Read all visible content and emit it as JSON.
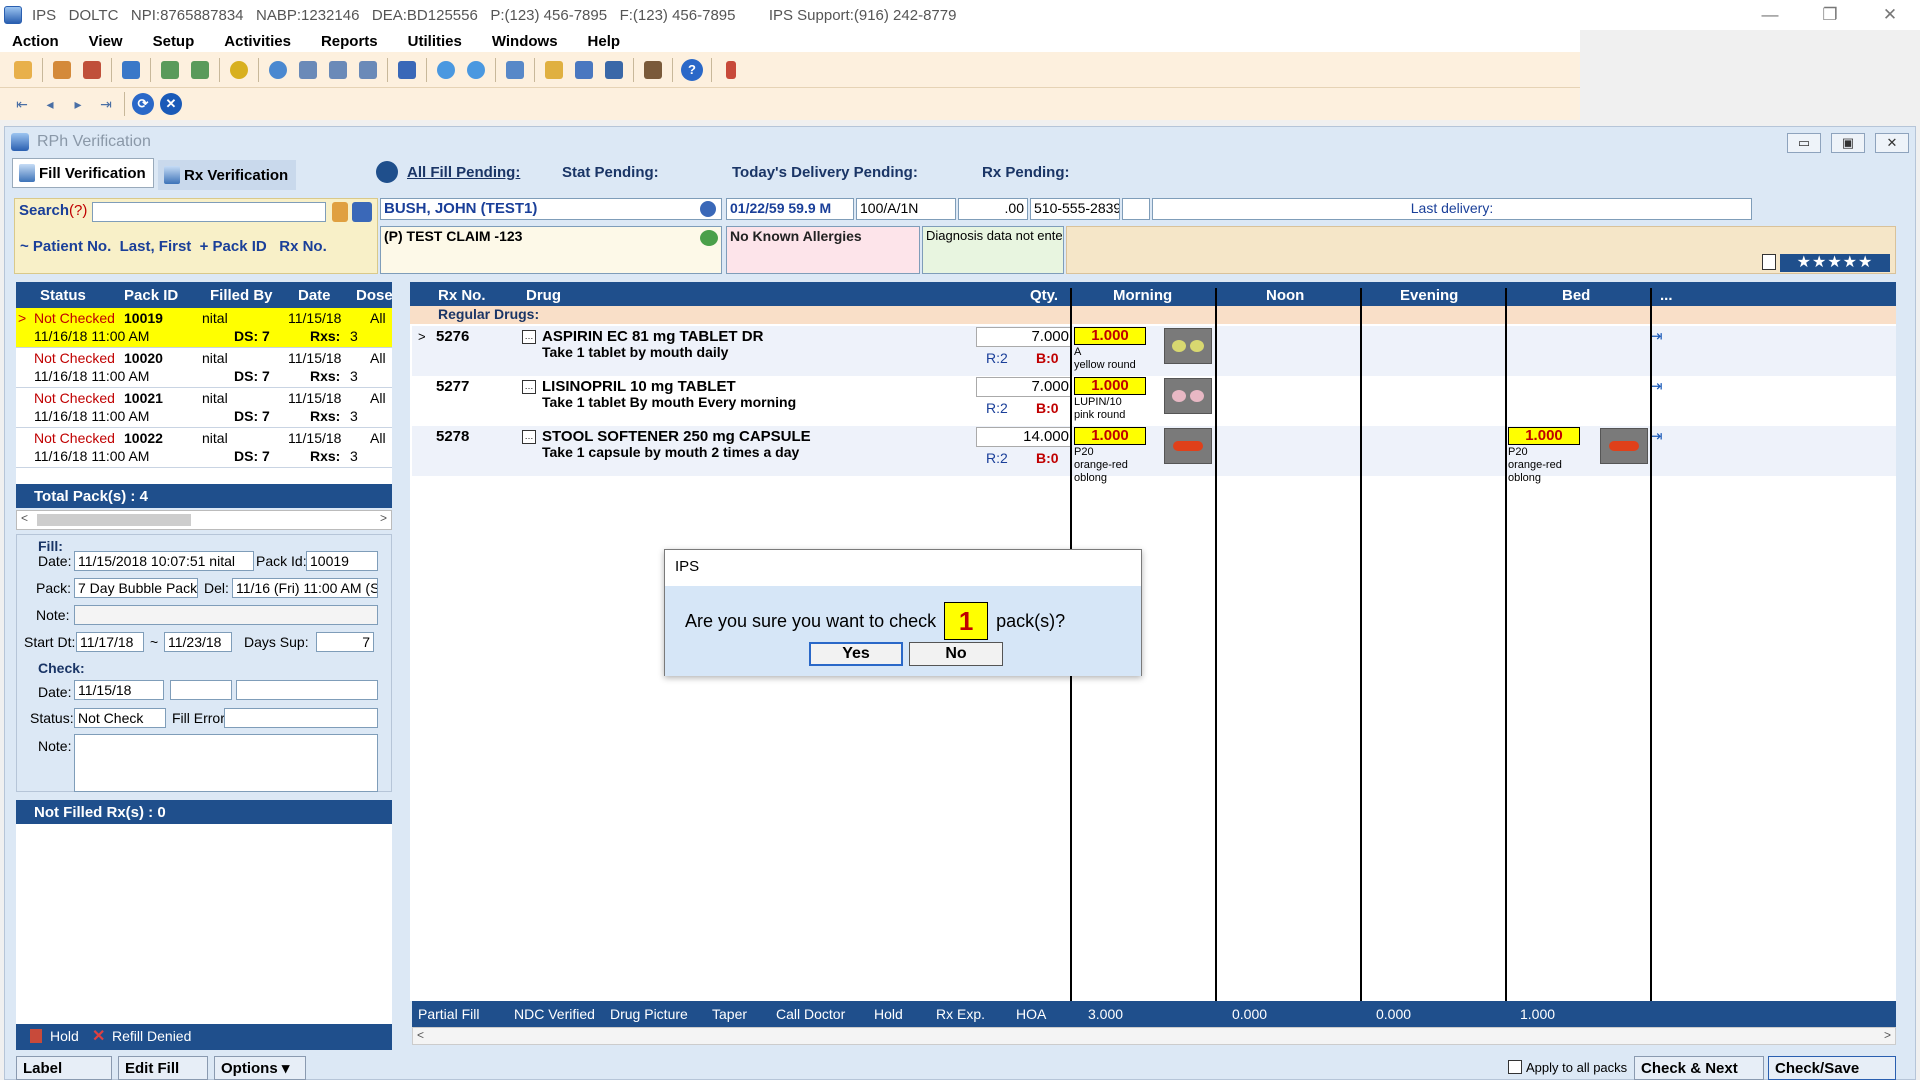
{
  "window": {
    "title": "IPS   DOLTC   NPI:8765887834   NABP:1232146   DEA:BD125556   P:(123) 456-7895   F:(123) 456-7895        IPS Support:(916) 242-8779",
    "minimize": "—",
    "restore": "❐",
    "close": "✕"
  },
  "menu": [
    "Action",
    "View",
    "Setup",
    "Activities",
    "Reports",
    "Utilities",
    "Windows",
    "Help"
  ],
  "toolbar": {
    "icons": [
      "user-icon",
      "users-icon",
      "home-icon",
      "pharmacy-icon",
      "export-icon",
      "import-icon",
      "money-icon",
      "search-icon",
      "filter-icon",
      "filter2-icon",
      "filter3-icon",
      "truck-icon",
      "merge-icon",
      "split-icon",
      "copy-icon",
      "folder-icon",
      "calendar-icon",
      "grid-icon",
      "book-icon",
      "help-icon",
      "exit-icon"
    ],
    "help": "?"
  },
  "nav": {
    "first": "⇤",
    "prev": "◂",
    "next": "▸",
    "last": "⇥",
    "refresh": "⟳",
    "stop": "✕"
  },
  "rph": {
    "title": "RPh Verification",
    "win_min": "▭",
    "win_max": "▣",
    "win_close": "✕",
    "tabs": {
      "fill": "Fill Verification",
      "rx": "Rx Verification"
    },
    "pending": {
      "all": "All Fill Pending:",
      "stat": "Stat Pending:",
      "today": "Today's Delivery Pending:",
      "rx": "Rx Pending:"
    },
    "search": {
      "label": "Search",
      "help": "(?)",
      "value": "",
      "hint": "~ Patient No.  Last, First  + Pack ID   Rx No."
    },
    "patient": {
      "name": "BUSH, JOHN  (TEST1)",
      "dob": "01/22/59 59.9 M",
      "room": "100/A/1N",
      "balance": ".00",
      "phone": "510-555-2839",
      "last_delivery": "Last delivery:",
      "claim": "(P) TEST CLAIM  -123",
      "allergies": "No Known Allergies",
      "diagnosis": "Diagnosis data not ente"
    },
    "packs": {
      "columns": [
        "Status",
        "Pack ID",
        "Filled By",
        "Date",
        "Dose"
      ],
      "rows": [
        {
          "status": "Not Checked",
          "pack_id": "10019",
          "filled_by": "nital",
          "date": "11/15/18",
          "dose": "All",
          "datetime": "11/16/18 11:00 AM",
          "ds": "DS: 7",
          "rxs_label": "Rxs:",
          "rxs": "3",
          "marker": ">"
        },
        {
          "status": "Not Checked",
          "pack_id": "10020",
          "filled_by": "nital",
          "date": "11/15/18",
          "dose": "All",
          "datetime": "11/16/18 11:00 AM",
          "ds": "DS: 7",
          "rxs_label": "Rxs:",
          "rxs": "3",
          "marker": ""
        },
        {
          "status": "Not Checked",
          "pack_id": "10021",
          "filled_by": "nital",
          "date": "11/15/18",
          "dose": "All",
          "datetime": "11/16/18 11:00 AM",
          "ds": "DS: 7",
          "rxs_label": "Rxs:",
          "rxs": "3",
          "marker": ""
        },
        {
          "status": "Not Checked",
          "pack_id": "10022",
          "filled_by": "nital",
          "date": "11/15/18",
          "dose": "All",
          "datetime": "11/16/18 11:00 AM",
          "ds": "DS: 7",
          "rxs_label": "Rxs:",
          "rxs": "3",
          "marker": ""
        }
      ],
      "total": "Total Pack(s) : 4"
    },
    "fill": {
      "heading": "Fill:",
      "date_label": "Date:",
      "date": "11/15/2018 10:07:51 nital",
      "packid_label": "Pack Id:",
      "pack_id": "10019",
      "pack_label": "Pack:",
      "pack": "7 Day Bubble Pack",
      "del_label": "Del:",
      "del": "11/16 (Fri)  11:00 AM (S",
      "note_label": "Note:",
      "note": "",
      "startdt_label": "Start Dt:",
      "start": "11/17/18",
      "dash": "~",
      "end": "11/23/18",
      "dayssup_label": "Days Sup:",
      "days_sup": "7"
    },
    "check": {
      "heading": "Check:",
      "date_label": "Date:",
      "date": "11/15/18",
      "status_label": "Status:",
      "status": "Not Check",
      "fillerror_label": "Fill Error:",
      "fill_error": "",
      "note_label": "Note:"
    },
    "not_filled": "Not Filled Rx(s) : 0",
    "left_footer": {
      "hold": "Hold",
      "refill_denied": "Refill Denied"
    },
    "grid": {
      "columns": [
        "Rx No.",
        "Drug",
        "Qty.",
        "Morning",
        "Noon",
        "Evening",
        "Bed",
        "..."
      ],
      "section": "Regular Drugs:"
    },
    "drugs": [
      {
        "marker": ">",
        "rx": "5276",
        "name": "ASPIRIN EC 81 mg TABLET DR",
        "sig": "Take 1 tablet by mouth daily",
        "qty": "7.000",
        "r": "R:2",
        "b": "B:0",
        "morning": "1.000",
        "morning_desc": "A\nyellow round",
        "bed": "",
        "bed_desc": "",
        "pill_color": "#d8d870",
        "pill_shape": "round"
      },
      {
        "marker": "",
        "rx": "5277",
        "name": "LISINOPRIL 10 mg TABLET",
        "sig": "Take 1 tablet By mouth Every morning",
        "qty": "7.000",
        "r": "R:2",
        "b": "B:0",
        "morning": "1.000",
        "morning_desc": "LUPIN/10\npink round",
        "bed": "",
        "bed_desc": "",
        "pill_color": "#e8b8c4",
        "pill_shape": "round"
      },
      {
        "marker": "",
        "rx": "5278",
        "name": "STOOL SOFTENER 250 mg CAPSULE",
        "sig": "Take 1 capsule by mouth 2 times a day",
        "qty": "14.000",
        "r": "R:2",
        "b": "B:0",
        "morning": "1.000",
        "morning_desc": "P20\norange-red\noblong",
        "bed": "1.000",
        "bed_desc": "P20\norange-red\noblong",
        "pill_color": "#e0401a",
        "pill_shape": "oblong"
      }
    ],
    "bottom": {
      "partial": "Partial Fill",
      "ndc": "NDC Verified",
      "picture": "Drug Picture",
      "taper": "Taper",
      "call": "Call Doctor",
      "hold": "Hold",
      "rxexp": "Rx Exp.",
      "hoa": "HOA",
      "totals": [
        "3.000",
        "0.000",
        "0.000",
        "1.000"
      ]
    },
    "buttons": {
      "label": "Label",
      "edit_fill": "Edit Fill",
      "options": "Options",
      "apply_all": "Apply to all packs",
      "check_next": "Check & Next",
      "check_save": "Check/Save"
    }
  },
  "dialog": {
    "title": "IPS",
    "message_pre": "Are you sure you want to check",
    "count": "1",
    "message_post": "pack(s)?",
    "yes": "Yes",
    "no": "No"
  },
  "colors": {
    "header_blue": "#1f4f8c",
    "toolbar_bg": "#fdf0de",
    "highlight_yellow": "#ffff00",
    "status_red": "#c00000"
  }
}
